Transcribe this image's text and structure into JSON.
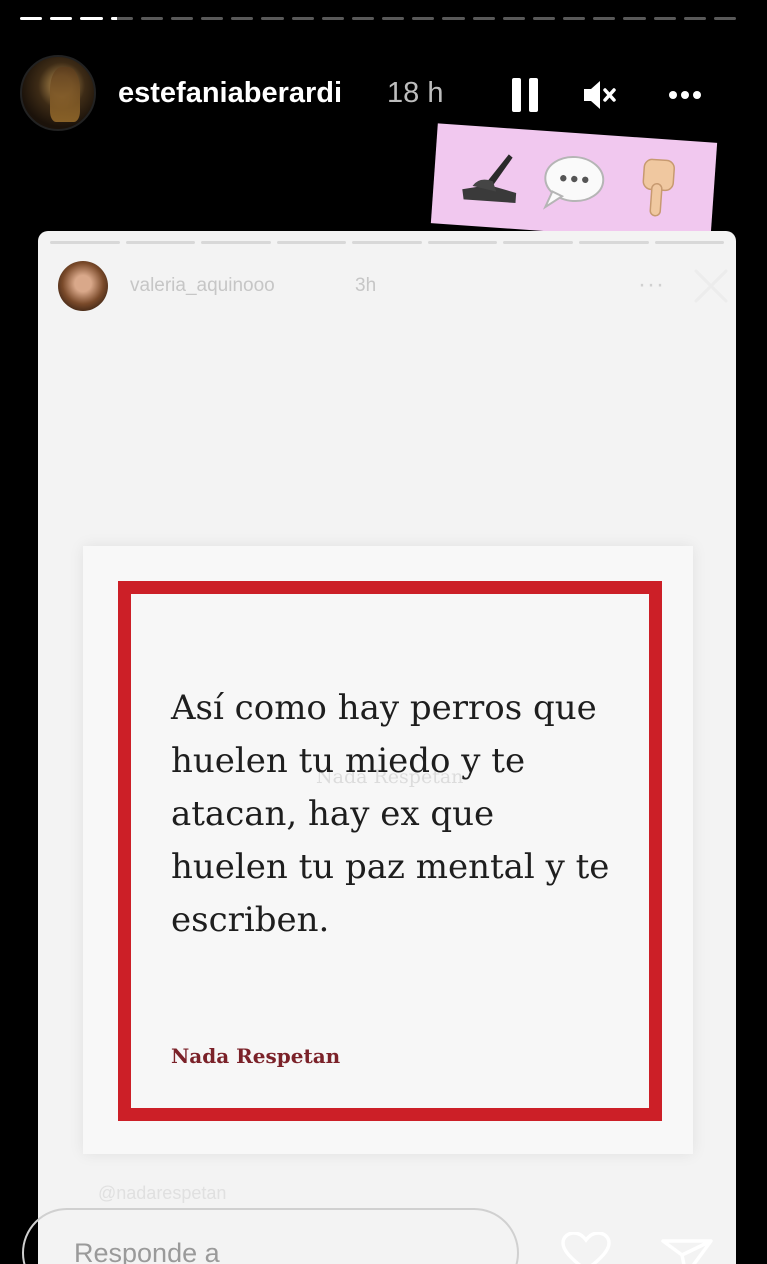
{
  "story": {
    "segments": [
      1.0,
      1.0,
      1.0,
      0.3,
      0,
      0,
      0,
      0,
      0,
      0,
      0,
      0,
      0,
      0,
      0,
      0,
      0,
      0,
      0,
      0,
      0,
      0,
      0,
      0
    ],
    "username": "estefaniaberardi",
    "time": "18 h",
    "icons": {
      "pause": "pause-icon",
      "mute": "speaker-muted-icon",
      "more": "more-dots-icon"
    }
  },
  "sticker": {
    "emojis": [
      "writing-hand-icon",
      "speech-bubble-icon",
      "pointing-down-icon"
    ]
  },
  "shared_story": {
    "username": "valeria_aquinooo",
    "time": "3h",
    "more": "···",
    "segments": [
      1,
      1,
      1,
      1,
      1,
      1,
      1,
      1,
      1
    ],
    "post": {
      "quote": "Así como hay perros que huelen tu miedo y te atacan, hay ex que huelen tu paz mental y te escriben.",
      "watermark": "Nada Respetan",
      "signature": "Nada Respetan",
      "frame_color": "#cc1f27"
    },
    "handle": "@nadarespetan"
  },
  "reply": {
    "placeholder": "Responde a"
  }
}
